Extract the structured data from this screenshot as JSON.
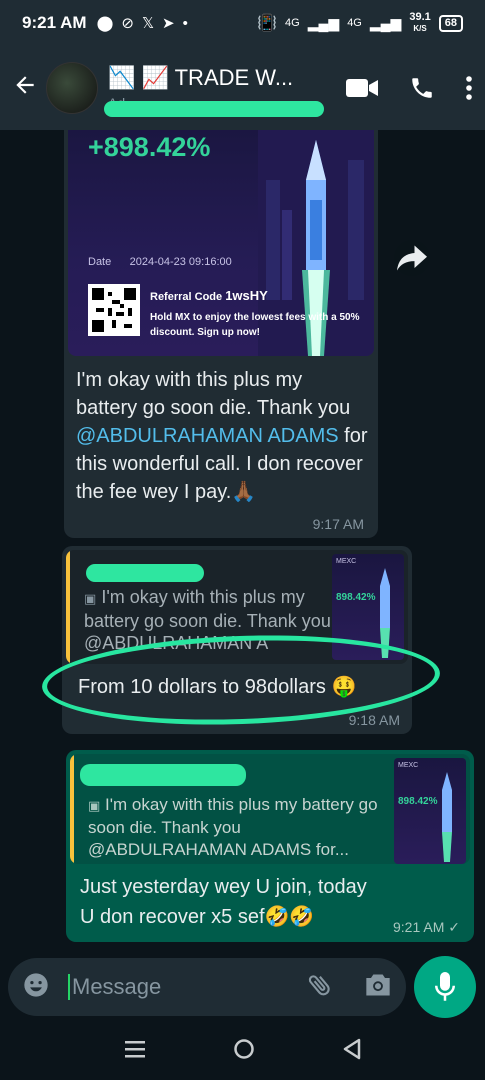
{
  "status_bar": {
    "time": "9:21 AM",
    "net_speed": "39.1",
    "net_unit": "K/S",
    "battery": "68",
    "signal1": "4G",
    "signal2": "4G"
  },
  "header": {
    "title": "📉 📈 TRADE W...",
    "subtitle": "Ad"
  },
  "messages": [
    {
      "poster": {
        "percent": "+898.42%",
        "date_label": "Date",
        "date_value": "2024-04-23 09:16:00",
        "referral_label": "Referral Code",
        "referral_code": "1wsHY",
        "promo": "Hold MX to enjoy the lowest fees with a 50% discount. Sign up now!"
      },
      "text_before": "I'm okay with this plus my battery go soon die. Thank you ",
      "mention": "@ABDULRAHAMAN ADAMS",
      "text_after": " for this wonderful call. I don recover the fee wey I pay.🙏🏾",
      "time": "9:17 AM"
    },
    {
      "quote_text": "I'm okay with this plus my battery go soon die. Thank you @ABDULRAHAMAN A",
      "thumb_label": "MEXC",
      "thumb_percent": "898.42%",
      "text": "From 10 dollars to 98dollars 🤑",
      "time": "9:18 AM"
    },
    {
      "quote_text": "I'm okay with this plus my battery go soon die. Thank you @ABDULRAHAMAN ADAMS for...",
      "thumb_label": "MEXC",
      "thumb_percent": "898.42%",
      "text": "Just yesterday wey U join, today U don recover x5 sef🤣🤣",
      "time": "9:21 AM",
      "tick": "✓"
    }
  ],
  "input": {
    "placeholder": "Message"
  },
  "icons": {
    "back": "arrow-left-icon",
    "video": "video-call-icon",
    "call": "phone-icon",
    "menu": "more-vert-icon",
    "emoji": "emoji-icon",
    "attach": "paperclip-icon",
    "camera": "camera-icon",
    "mic": "microphone-icon",
    "forward": "forward-icon"
  },
  "colors": {
    "incoming_bubble": "#202c33",
    "outgoing_bubble": "#005c4b",
    "accent": "#00a884",
    "highlight_marker": "#28e6a0"
  }
}
